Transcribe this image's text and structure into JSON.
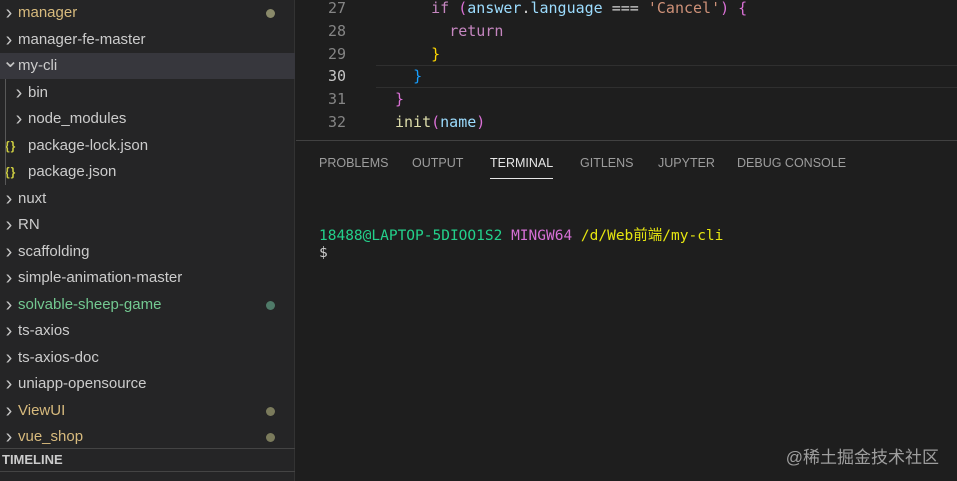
{
  "explorer": {
    "items": [
      {
        "label": "manager",
        "type": "folder",
        "expanded": false,
        "color": "#d7ba7d",
        "dot": "#8a8a6a"
      },
      {
        "label": "manager-fe-master",
        "type": "folder",
        "expanded": false,
        "color": "#cccccc"
      },
      {
        "label": "my-cli",
        "type": "folder",
        "expanded": true,
        "color": "#cccccc",
        "selected": true
      },
      {
        "label": "bin",
        "type": "folder",
        "indent": 1,
        "color": "#cccccc"
      },
      {
        "label": "node_modules",
        "type": "folder",
        "indent": 1,
        "color": "#cccccc"
      },
      {
        "label": "package-lock.json",
        "type": "json",
        "indent": 1,
        "color": "#cccccc"
      },
      {
        "label": "package.json",
        "type": "json",
        "indent": 1,
        "color": "#cccccc"
      },
      {
        "label": "nuxt",
        "type": "folder",
        "color": "#cccccc"
      },
      {
        "label": "RN",
        "type": "folder",
        "color": "#cccccc"
      },
      {
        "label": "scaffolding",
        "type": "folder",
        "color": "#cccccc"
      },
      {
        "label": "simple-animation-master",
        "type": "folder",
        "color": "#cccccc"
      },
      {
        "label": "solvable-sheep-game",
        "type": "folder",
        "color": "#73c991",
        "dot": "#4f7a68"
      },
      {
        "label": "ts-axios",
        "type": "folder",
        "color": "#cccccc"
      },
      {
        "label": "ts-axios-doc",
        "type": "folder",
        "color": "#cccccc"
      },
      {
        "label": "uniapp-opensource",
        "type": "folder",
        "color": "#cccccc"
      },
      {
        "label": "ViewUI",
        "type": "folder",
        "color": "#d7ba7d",
        "dot": "#7b7b5c"
      },
      {
        "label": "vue_shop",
        "type": "folder",
        "color": "#d7ba7d",
        "dot": "#7b7b5c"
      }
    ],
    "timeline_label": "TIMELINE"
  },
  "editor": {
    "lines": [
      {
        "n": "27",
        "indent": "    ",
        "tokens": [
          [
            "if ",
            "#c586c0"
          ],
          [
            "(",
            "#da70d6"
          ],
          [
            "answer",
            "#9cdcfe"
          ],
          [
            ".",
            "#d4d4d4"
          ],
          [
            "language",
            "#9cdcfe"
          ],
          [
            " === ",
            "#d4d4d4"
          ],
          [
            "'Cancel'",
            "#ce9178"
          ],
          [
            ")",
            "#da70d6"
          ],
          [
            " {",
            "#da70d6"
          ]
        ]
      },
      {
        "n": "28",
        "indent": "      ",
        "tokens": [
          [
            "return",
            "#c586c0"
          ]
        ]
      },
      {
        "n": "29",
        "indent": "    ",
        "tokens": [
          [
            "}",
            "#ffd700"
          ]
        ]
      },
      {
        "n": "30",
        "indent": "  ",
        "tokens": [
          [
            "}",
            "#179fff"
          ]
        ]
      },
      {
        "n": "31",
        "indent": "",
        "tokens": [
          [
            "}",
            "#da70d6"
          ]
        ]
      },
      {
        "n": "32",
        "indent": "",
        "tokens": [
          [
            "init",
            "#dcdcaa"
          ],
          [
            "(",
            "#da70d6"
          ],
          [
            "name",
            "#9cdcfe"
          ],
          [
            ")",
            "#da70d6"
          ]
        ]
      }
    ],
    "current_line": "30"
  },
  "panel": {
    "tabs": [
      "PROBLEMS",
      "OUTPUT",
      "TERMINAL",
      "GITLENS",
      "JUPYTER",
      "DEBUG CONSOLE"
    ],
    "active_tab": "TERMINAL",
    "terminal": {
      "user": "18488@LAPTOP-5DIOO1S2",
      "system": "MINGW64",
      "path": "/d/Web前端/my-cli",
      "prompt": "$"
    }
  },
  "watermark": "@稀土掘金技术社区"
}
